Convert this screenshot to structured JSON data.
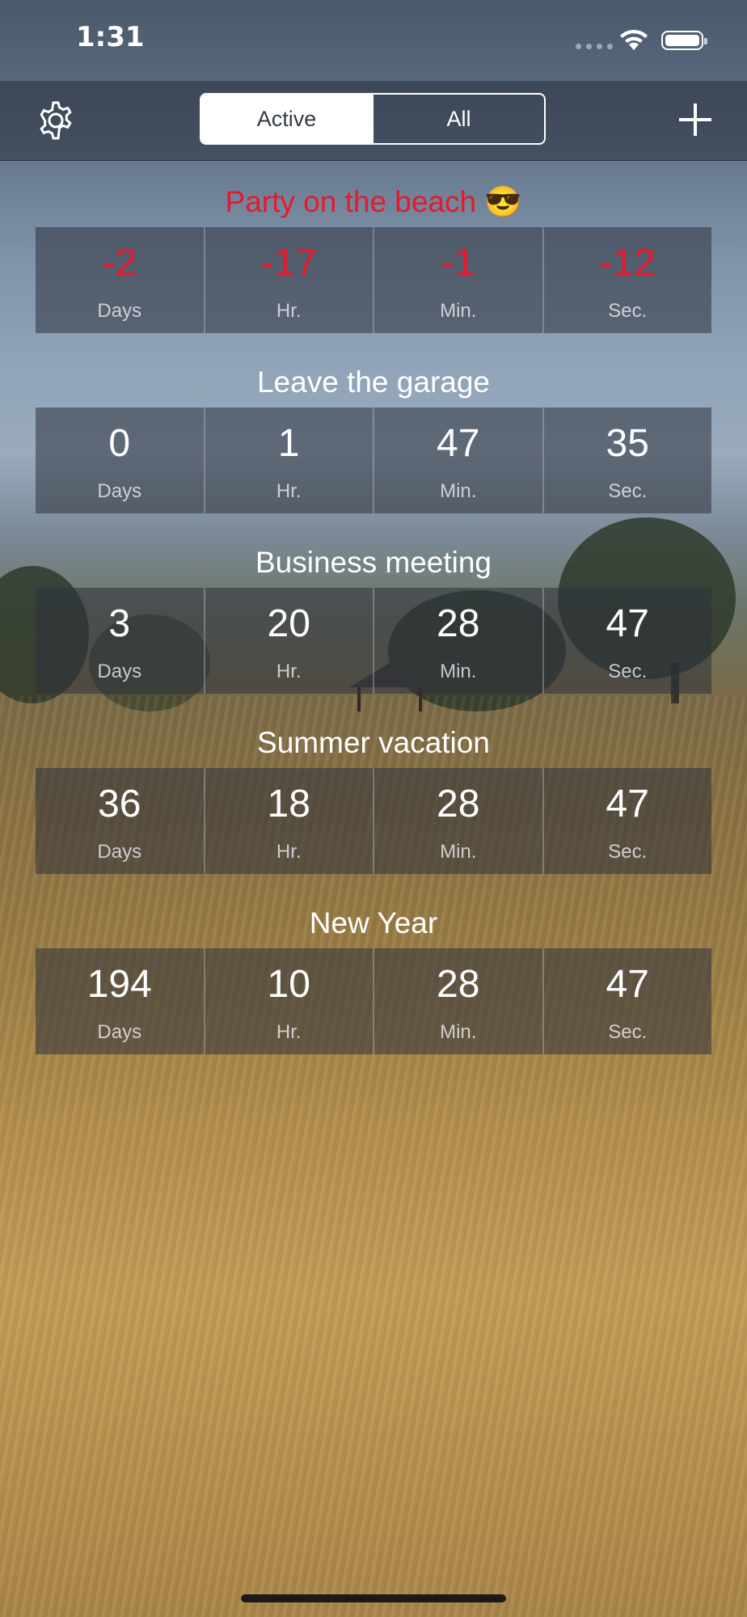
{
  "status_bar": {
    "time": "1:31"
  },
  "nav": {
    "segments": [
      {
        "label": "Active",
        "selected": true
      },
      {
        "label": "All",
        "selected": false
      }
    ],
    "settings_icon": "gear-icon",
    "add_icon": "plus-icon"
  },
  "colors": {
    "overdue": "#e8192c",
    "accent": "#ffffff"
  },
  "events": [
    {
      "title": "Party on the beach 😎",
      "overdue": true,
      "counters": [
        {
          "value": "-2",
          "unit": "Days"
        },
        {
          "value": "-17",
          "unit": "Hr."
        },
        {
          "value": "-1",
          "unit": "Min."
        },
        {
          "value": "-12",
          "unit": "Sec."
        }
      ]
    },
    {
      "title": "Leave the garage",
      "overdue": false,
      "counters": [
        {
          "value": "0",
          "unit": "Days"
        },
        {
          "value": "1",
          "unit": "Hr."
        },
        {
          "value": "47",
          "unit": "Min."
        },
        {
          "value": "35",
          "unit": "Sec."
        }
      ]
    },
    {
      "title": "Business meeting",
      "overdue": false,
      "counters": [
        {
          "value": "3",
          "unit": "Days"
        },
        {
          "value": "20",
          "unit": "Hr."
        },
        {
          "value": "28",
          "unit": "Min."
        },
        {
          "value": "47",
          "unit": "Sec."
        }
      ]
    },
    {
      "title": "Summer vacation",
      "overdue": false,
      "counters": [
        {
          "value": "36",
          "unit": "Days"
        },
        {
          "value": "18",
          "unit": "Hr."
        },
        {
          "value": "28",
          "unit": "Min."
        },
        {
          "value": "47",
          "unit": "Sec."
        }
      ]
    },
    {
      "title": "New Year",
      "overdue": false,
      "counters": [
        {
          "value": "194",
          "unit": "Days"
        },
        {
          "value": "10",
          "unit": "Hr."
        },
        {
          "value": "28",
          "unit": "Min."
        },
        {
          "value": "47",
          "unit": "Sec."
        }
      ]
    }
  ]
}
